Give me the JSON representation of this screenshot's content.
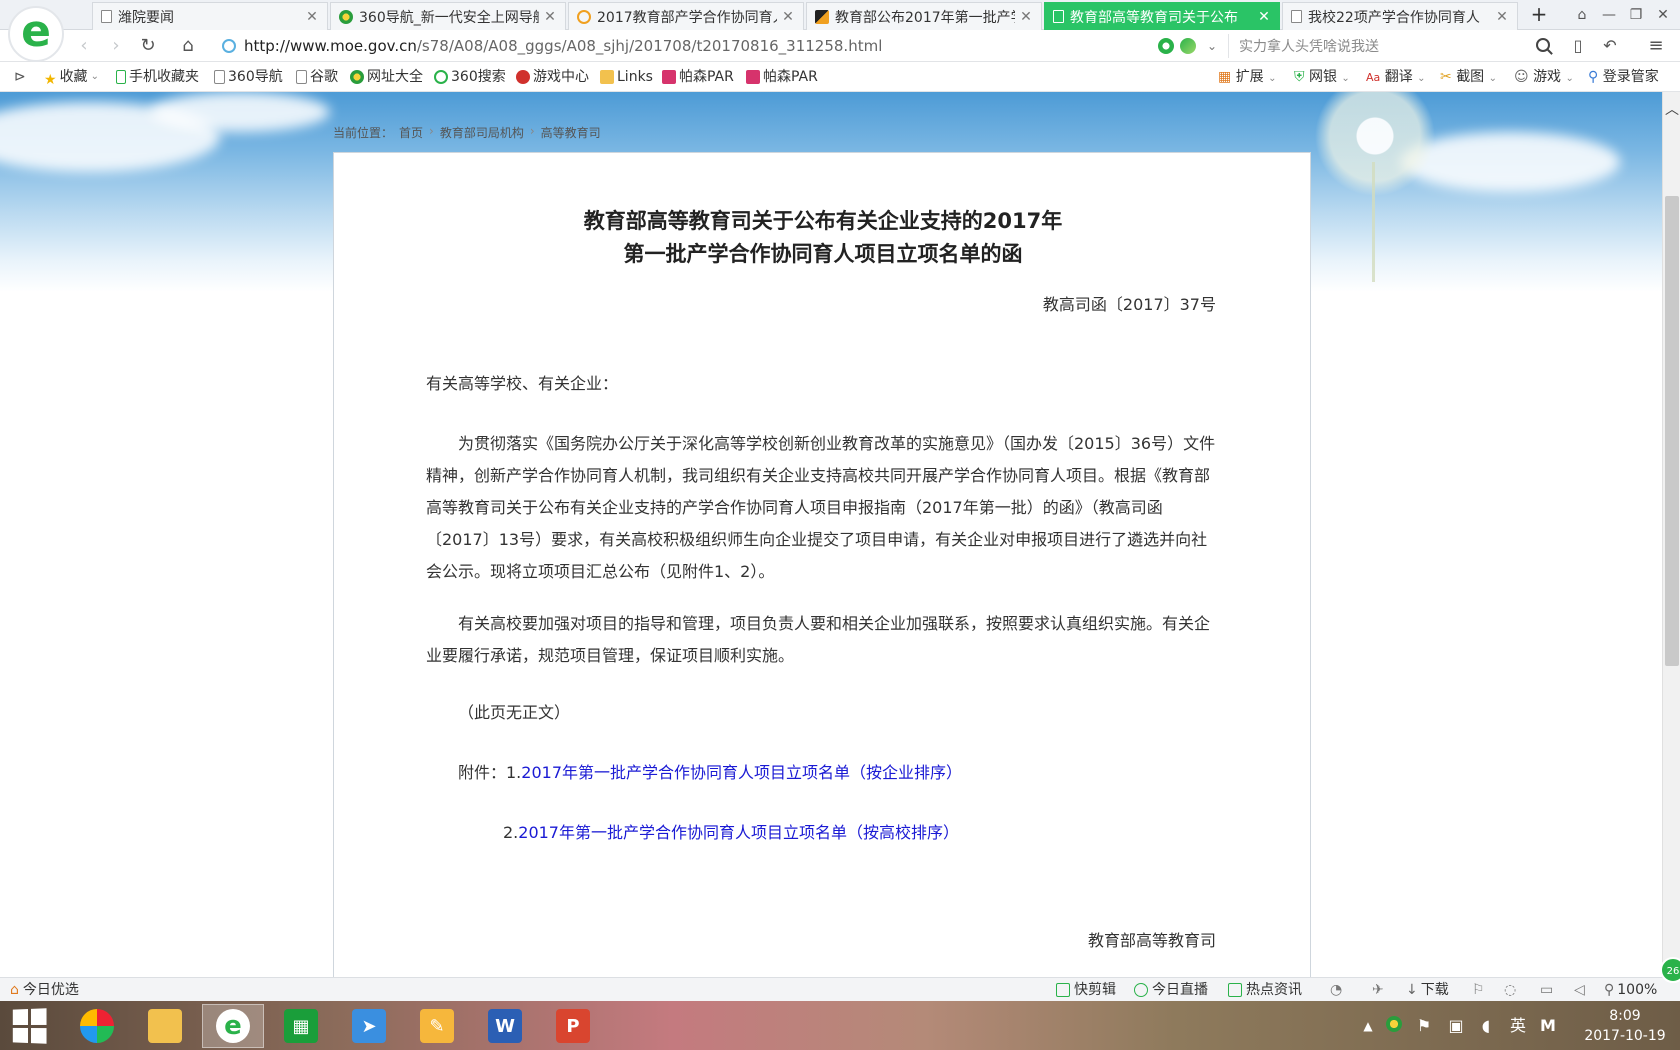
{
  "tabs": [
    {
      "label": "潍院要闻",
      "icon": "document-icon",
      "active": false
    },
    {
      "label": "360导航_新一代安全上网导航",
      "icon": "360-nav-icon",
      "active": false
    },
    {
      "label": "2017教育部产学合作协同育人",
      "icon": "search-ring-icon",
      "active": false
    },
    {
      "label": "教育部公布2017年第一批产学",
      "icon": "bird-icon",
      "active": false
    },
    {
      "label": "教育部高等教育司关于公布",
      "icon": "document-icon",
      "active": true
    },
    {
      "label": "我校22项产学合作协同育人",
      "icon": "document-icon",
      "active": false
    }
  ],
  "address": {
    "url_host": "http://www.moe.gov.cn",
    "url_path": "/s78/A08/A08_gggs/A08_sjhj/201708/t20170816_311258.html",
    "search_placeholder": "实力拿人头凭啥说我送"
  },
  "bookmarks": {
    "items": [
      {
        "label": "收藏",
        "icon": "star-icon"
      },
      {
        "label": "手机收藏夹",
        "icon": "phone-icon"
      },
      {
        "label": "360导航",
        "icon": "document-icon"
      },
      {
        "label": "谷歌",
        "icon": "document-icon"
      },
      {
        "label": "网址大全",
        "icon": "360-nav-icon"
      },
      {
        "label": "360搜索",
        "icon": "search-ring-icon"
      },
      {
        "label": "游戏中心",
        "icon": "game-icon"
      },
      {
        "label": "Links",
        "icon": "folder-icon"
      },
      {
        "label": "帕森PAR",
        "icon": "pink-icon"
      },
      {
        "label": "帕森PAR",
        "icon": "pink-icon"
      }
    ],
    "right": {
      "extend": "扩展",
      "bank": "网银",
      "translate": "翻译",
      "screenshot": "截图",
      "games": "游戏",
      "login": "登录管家"
    }
  },
  "breadcrumb": {
    "prefix": "当前位置：",
    "items": [
      "首页",
      "教育部司局机构",
      "高等教育司"
    ]
  },
  "article": {
    "title_line1": "教育部高等教育司关于公布有关企业支持的2017年",
    "title_line2": "第一批产学合作协同育人项目立项名单的函",
    "doc_number": "教高司函〔2017〕37号",
    "salutation": "有关高等学校、有关企业：",
    "para1": "为贯彻落实《国务院办公厅关于深化高等学校创新创业教育改革的实施意见》（国办发〔2015〕36号）文件精神，创新产学合作协同育人机制，我司组织有关企业支持高校共同开展产学合作协同育人项目。根据《教育部高等教育司关于公布有关企业支持的产学合作协同育人项目申报指南（2017年第一批）的函》（教高司函〔2017〕13号）要求，有关高校积极组织师生向企业提交了项目申请，有关企业对申报项目进行了遴选并向社会公示。现将立项项目汇总公布（见附件1、2）。",
    "para2": "有关高校要加强对项目的指导和管理，项目负责人要和相关企业加强联系，按照要求认真组织实施。有关企业要履行承诺，规范项目管理，保证项目顺利实施。",
    "no_text": "（此页无正文）",
    "attach_prefix": "附件：1.",
    "attach1": "2017年第一批产学合作协同育人项目立项名单（按企业排序）",
    "attach2_prefix": "2.",
    "attach2": "2017年第一批产学合作协同育人项目立项名单（按高校排序）",
    "signature": "教育部高等教育司"
  },
  "statusbar": {
    "left": "今日优选",
    "quick_edit": "快剪辑",
    "live": "今日直播",
    "hot_news": "热点资讯",
    "download": "下载",
    "zoom": "100%"
  },
  "taskbar": {
    "ime": "英",
    "ime2": "M",
    "time": "8:09",
    "date": "2017-10-19",
    "badge": "26"
  }
}
